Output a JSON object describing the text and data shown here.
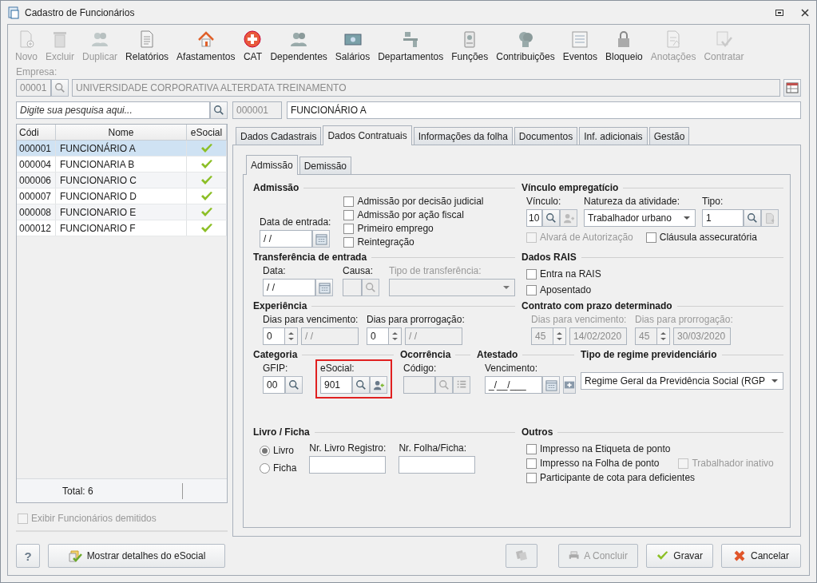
{
  "window": {
    "title": "Cadastro de Funcionários"
  },
  "toolbar": [
    {
      "label": "Novo",
      "kind": "new",
      "disabled": true
    },
    {
      "label": "Excluir",
      "kind": "trash",
      "disabled": true
    },
    {
      "label": "Duplicar",
      "kind": "people",
      "disabled": true
    },
    {
      "label": "Relatórios",
      "kind": "report",
      "disabled": false
    },
    {
      "label": "Afastamentos",
      "kind": "house",
      "disabled": false
    },
    {
      "label": "CAT",
      "kind": "cross",
      "disabled": false
    },
    {
      "label": "Dependentes",
      "kind": "people",
      "disabled": false
    },
    {
      "label": "Salários",
      "kind": "money",
      "disabled": false
    },
    {
      "label": "Departamentos",
      "kind": "desk",
      "disabled": false
    },
    {
      "label": "Funções",
      "kind": "badge",
      "disabled": false
    },
    {
      "label": "Contribuições",
      "kind": "heads",
      "disabled": false
    },
    {
      "label": "Eventos",
      "kind": "list",
      "disabled": false
    },
    {
      "label": "Bloqueio",
      "kind": "lock",
      "disabled": false
    },
    {
      "label": "Anotações",
      "kind": "note",
      "disabled": true
    },
    {
      "label": "Contratar",
      "kind": "check",
      "disabled": true
    }
  ],
  "empresa": {
    "label": "Empresa:",
    "code": "00001",
    "name": "UNIVERSIDADE CORPORATIVA ALTERDATA TREINAMENTO"
  },
  "search": {
    "placeholder": "Digite sua pesquisa aqui..."
  },
  "employee": {
    "code": "000001",
    "name": "FUNCIONÁRIO A"
  },
  "list": {
    "columns": [
      "Códi",
      "Nome",
      "eSocial"
    ],
    "rows": [
      {
        "code": "000001",
        "name": "FUNCIONÁRIO A",
        "esocial": true,
        "selected": true
      },
      {
        "code": "000004",
        "name": "FUNCIONARIA B",
        "esocial": true,
        "selected": false
      },
      {
        "code": "000006",
        "name": "FUNCIONARIO C",
        "esocial": true,
        "selected": false
      },
      {
        "code": "000007",
        "name": "FUNCIONARIO D",
        "esocial": true,
        "selected": false
      },
      {
        "code": "000008",
        "name": "FUNCIONARIO E",
        "esocial": true,
        "selected": false
      },
      {
        "code": "000012",
        "name": "FUNCIONARIO F",
        "esocial": true,
        "selected": false
      }
    ],
    "total": "Total: 6"
  },
  "show_dismissed": {
    "label": "Exibir Funcionários demitidos",
    "checked": false,
    "disabled": true
  },
  "tabs": [
    {
      "label": "Dados Cadastrais",
      "selected": false
    },
    {
      "label": "Dados Contratuais",
      "selected": true
    },
    {
      "label": "Informações da folha",
      "selected": false
    },
    {
      "label": "Documentos",
      "selected": false
    },
    {
      "label": "Inf. adicionais",
      "selected": false
    },
    {
      "label": "Gestão",
      "selected": false
    }
  ],
  "subtabs": [
    {
      "label": "Admissão",
      "selected": true
    },
    {
      "label": "Demissão",
      "selected": false
    }
  ],
  "admissao": {
    "title": "Admissão",
    "date_label": "Data de entrada:",
    "date_value": "/ /",
    "checks": [
      {
        "label": "Admissão por decisão judicial",
        "checked": false
      },
      {
        "label": "Admissão por ação fiscal",
        "checked": false
      },
      {
        "label": "Primeiro emprego",
        "checked": false
      },
      {
        "label": "Reintegração",
        "checked": false
      }
    ]
  },
  "vinculo": {
    "title": "Vínculo empregatício",
    "vinculo_label": "Vínculo:",
    "vinculo_value": "10",
    "natureza_label": "Natureza da atividade:",
    "natureza_value": "Trabalhador urbano",
    "tipo_label": "Tipo:",
    "tipo_value": "1",
    "checks": [
      {
        "label": "Alvará de Autorização",
        "checked": false,
        "disabled": true
      },
      {
        "label": "Cláusula assecuratória",
        "checked": false,
        "disabled": false
      }
    ]
  },
  "transferencia": {
    "title": "Transferência de entrada",
    "data_label": "Data:",
    "data_value": "/ /",
    "causa_label": "Causa:",
    "tipo_label": "Tipo de transferência:"
  },
  "rais": {
    "title": "Dados RAIS",
    "checks": [
      {
        "label": "Entra na RAIS",
        "checked": false
      },
      {
        "label": "Aposentado",
        "checked": false
      }
    ]
  },
  "experiencia": {
    "title": "Experiência",
    "venc_label": "Dias para vencimento:",
    "venc_days": "0",
    "venc_date": "/ /",
    "prorr_label": "Dias para prorrogação:",
    "prorr_days": "0",
    "prorr_date": "/ /",
    "disabled": false
  },
  "contrato": {
    "title": "Contrato com prazo determinado",
    "venc_label": "Dias para vencimento:",
    "venc_days": "45",
    "venc_date": "14/02/2020",
    "prorr_label": "Dias para prorrogação:",
    "prorr_days": "45",
    "prorr_date": "30/03/2020",
    "disabled": true
  },
  "categoria": {
    "title": "Categoria",
    "gfip_label": "GFIP:",
    "gfip_value": "00",
    "esocial_label": "eSocial:",
    "esocial_value": "901",
    "highlighted": true
  },
  "ocorrencia": {
    "title": "Ocorrência",
    "codigo_label": "Código:"
  },
  "atestado": {
    "title": "Atestado",
    "venc_label": "Vencimento:",
    "venc_value": "_/__/___"
  },
  "regime": {
    "title": "Tipo de regime previdenciário",
    "value": "Regime Geral da Previdência Social (RGP"
  },
  "livro": {
    "title": "Livro / Ficha",
    "radios": [
      {
        "label": "Livro",
        "selected": true
      },
      {
        "label": "Ficha",
        "selected": false
      }
    ],
    "nr_livro_label": "Nr. Livro Registro:",
    "nr_folha_label": "Nr. Folha/Ficha:"
  },
  "outros": {
    "title": "Outros",
    "checks": [
      {
        "label": "Impresso na Etiqueta de ponto",
        "checked": false,
        "disabled": false
      },
      {
        "label": "Impresso na Folha de ponto",
        "checked": false,
        "disabled": false
      },
      {
        "label": "Trabalhador inativo",
        "checked": false,
        "disabled": true
      },
      {
        "label": "Participante de cota para deficientes",
        "checked": false,
        "disabled": false
      }
    ]
  },
  "buttons": {
    "help": "?",
    "details": "Mostrar detalhes do eSocial",
    "conclude": {
      "label": "A Concluir",
      "disabled": true
    },
    "save": {
      "label": "Gravar",
      "disabled": false
    },
    "cancel": {
      "label": "Cancelar",
      "disabled": false
    }
  }
}
